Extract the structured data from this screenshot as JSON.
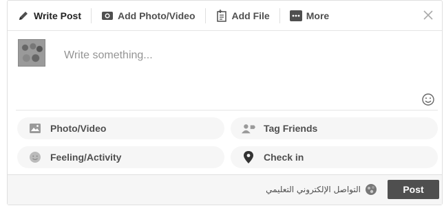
{
  "tabs": [
    {
      "label": "Write Post",
      "icon": "pencil-icon"
    },
    {
      "label": "Add Photo/Video",
      "icon": "camera-icon"
    },
    {
      "label": "Add File",
      "icon": "file-icon"
    },
    {
      "label": "More",
      "icon": "more-icon"
    }
  ],
  "composer": {
    "placeholder": "Write something..."
  },
  "actions": [
    {
      "label": "Photo/Video",
      "icon": "photo-icon"
    },
    {
      "label": "Tag Friends",
      "icon": "tag-friends-icon"
    },
    {
      "label": "Feeling/Activity",
      "icon": "smiley-icon"
    },
    {
      "label": "Check in",
      "icon": "location-pin-icon"
    }
  ],
  "footer": {
    "audience": "التواصل الإلكتروني التعليمي",
    "post_label": "Post"
  },
  "colors": {
    "text": "#4b4f56",
    "placeholder": "#90949c",
    "pill_bg": "#f5f6f7",
    "post_button": "#4b4f56"
  }
}
